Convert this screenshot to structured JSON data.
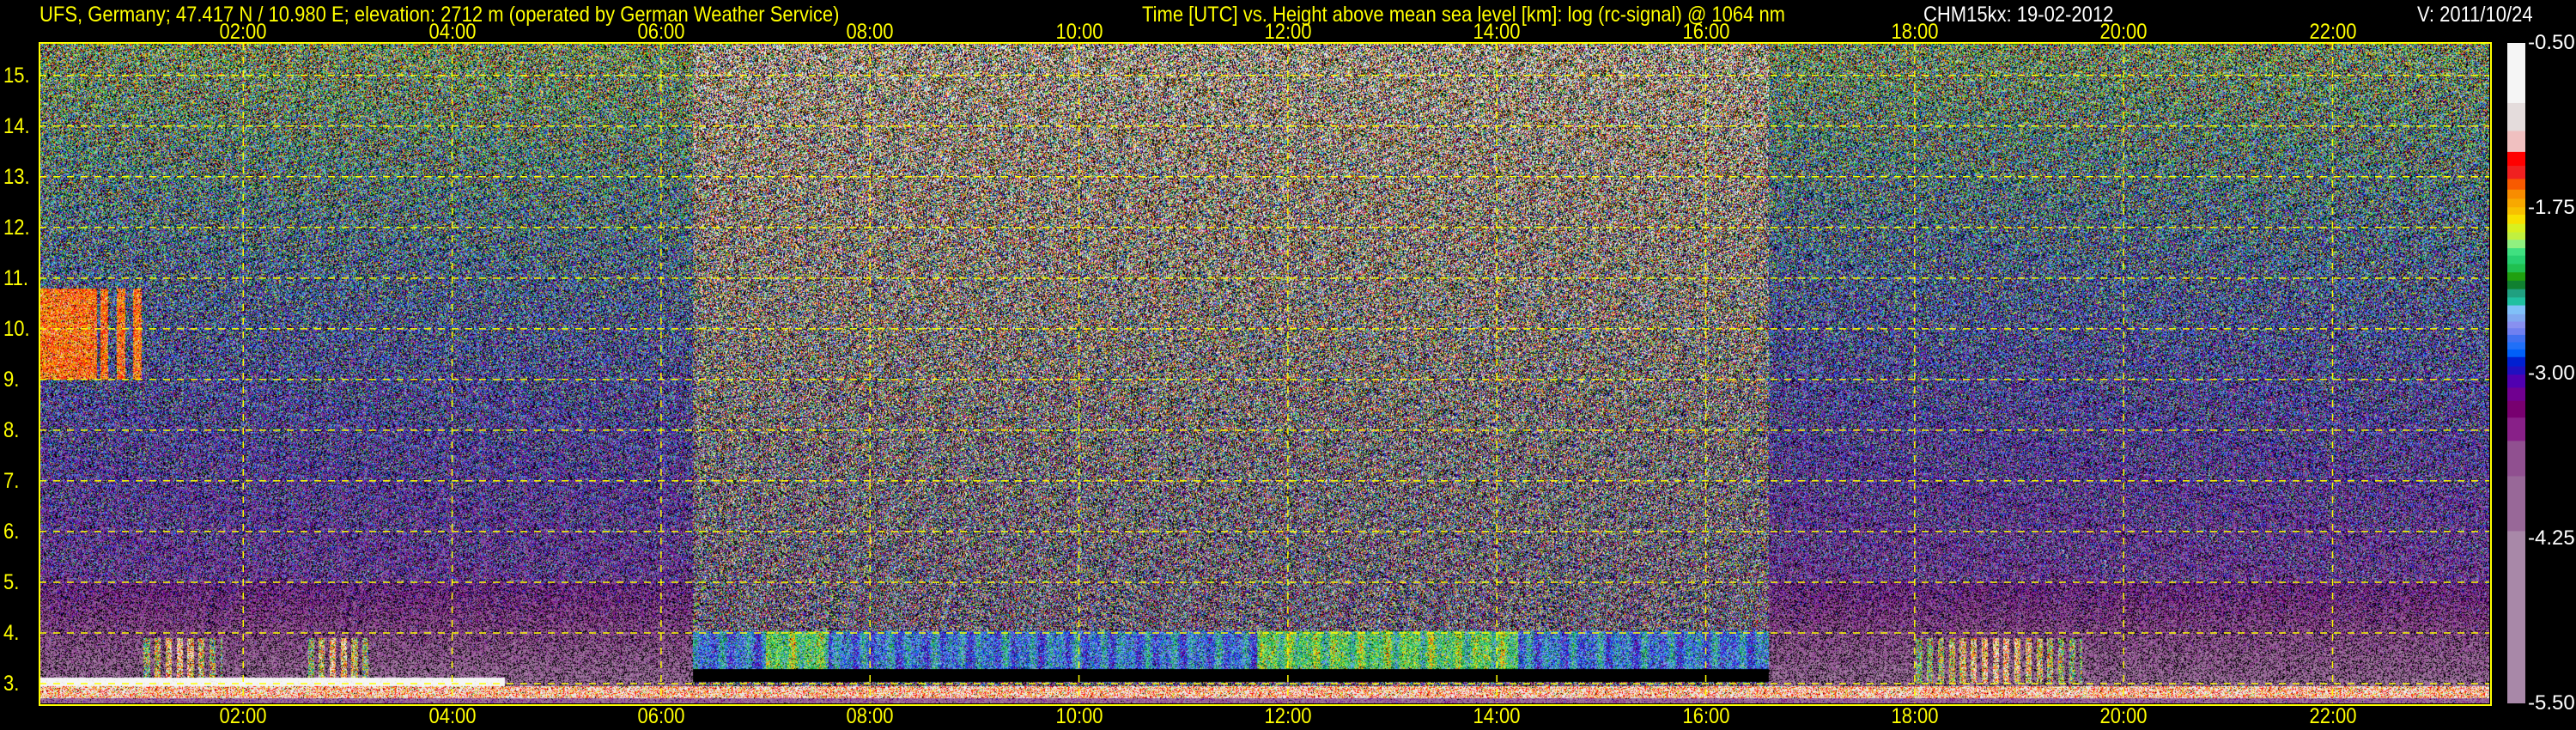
{
  "header": {
    "station": "UFS, Germany; 47.417 N / 10.980 E; elevation: 2712 m  (operated by German Weather Service)",
    "description": "Time [UTC] vs. Height above mean sea level [km]: log (rc-signal) @ 1064 nm",
    "instrument_date": "CHM15kx: 19-02-2012",
    "version": "V: 2011/10/24"
  },
  "chart_data": {
    "type": "heatmap",
    "title": "Time [UTC] vs. Height above mean sea level [km]: log (rc-signal) @ 1064 nm",
    "xlabel": "Time [UTC]",
    "ylabel": "Height above mean sea level [km]",
    "xlim_hours": [
      0.05,
      23.5
    ],
    "ylim_km": [
      2.61,
      15.64
    ],
    "x_ticks": [
      {
        "value": 2,
        "label": "02:00"
      },
      {
        "value": 4,
        "label": "04:00"
      },
      {
        "value": 6,
        "label": "06:00"
      },
      {
        "value": 8,
        "label": "08:00"
      },
      {
        "value": 10,
        "label": "10:00"
      },
      {
        "value": 12,
        "label": "12:00"
      },
      {
        "value": 14,
        "label": "14:00"
      },
      {
        "value": 16,
        "label": "16:00"
      },
      {
        "value": 18,
        "label": "18:00"
      },
      {
        "value": 20,
        "label": "20:00"
      },
      {
        "value": 22,
        "label": "22:00"
      }
    ],
    "y_ticks": [
      {
        "value": 3,
        "label": "3."
      },
      {
        "value": 4,
        "label": "4."
      },
      {
        "value": 5,
        "label": "5."
      },
      {
        "value": 6,
        "label": "6."
      },
      {
        "value": 7,
        "label": "7."
      },
      {
        "value": 8,
        "label": "8."
      },
      {
        "value": 9,
        "label": "9."
      },
      {
        "value": 10,
        "label": "10."
      },
      {
        "value": 11,
        "label": "11."
      },
      {
        "value": 12,
        "label": "12."
      },
      {
        "value": 13,
        "label": "13."
      },
      {
        "value": 14,
        "label": "14."
      },
      {
        "value": 15,
        "label": "15."
      }
    ],
    "grid": true,
    "grid_color": "#ffff00",
    "colorbar": {
      "range": [
        -5.5,
        -0.5
      ],
      "ticks": [
        {
          "value": -0.5,
          "label": "-0.50"
        },
        {
          "value": -1.75,
          "label": "-1.75"
        },
        {
          "value": -3.0,
          "label": "-3.00"
        },
        {
          "value": -4.25,
          "label": "-4.25"
        },
        {
          "value": -5.5,
          "label": "-5.50"
        }
      ],
      "levels": [
        {
          "lower": -0.955,
          "color": "#f5f5f5"
        },
        {
          "lower": -1.166,
          "color": "#e4dcdc"
        },
        {
          "lower": -1.325,
          "color": "#f0c0c0"
        },
        {
          "lower": -1.43,
          "color": "#ff0000"
        },
        {
          "lower": -1.53,
          "color": "#f02020"
        },
        {
          "lower": -1.61,
          "color": "#f85a00"
        },
        {
          "lower": -1.68,
          "color": "#f88c00"
        },
        {
          "lower": -1.744,
          "color": "#f8a800"
        },
        {
          "lower": -1.8,
          "color": "#f8c000"
        },
        {
          "lower": -1.87,
          "color": "#f8e000"
        },
        {
          "lower": -1.934,
          "color": "#d8f020"
        },
        {
          "lower": -1.99,
          "color": "#c0f040"
        },
        {
          "lower": -2.054,
          "color": "#90f080"
        },
        {
          "lower": -2.11,
          "color": "#40e080"
        },
        {
          "lower": -2.174,
          "color": "#28d070"
        },
        {
          "lower": -2.237,
          "color": "#20c050"
        },
        {
          "lower": -2.3,
          "color": "#20a010"
        },
        {
          "lower": -2.364,
          "color": "#108030"
        },
        {
          "lower": -2.427,
          "color": "#20a080"
        },
        {
          "lower": -2.487,
          "color": "#20c0a0"
        },
        {
          "lower": -2.554,
          "color": "#80c0f8"
        },
        {
          "lower": -2.61,
          "color": "#80a8f0"
        },
        {
          "lower": -2.66,
          "color": "#8890f0"
        },
        {
          "lower": -2.71,
          "color": "#7080f0"
        },
        {
          "lower": -2.766,
          "color": "#4070f0"
        },
        {
          "lower": -2.82,
          "color": "#2070f8"
        },
        {
          "lower": -2.878,
          "color": "#0060f8"
        },
        {
          "lower": -2.949,
          "color": "#0020d0"
        },
        {
          "lower": -3.012,
          "color": "#2010c0"
        },
        {
          "lower": -3.11,
          "color": "#5000b0"
        },
        {
          "lower": -3.21,
          "color": "#700090"
        },
        {
          "lower": -3.337,
          "color": "#780070"
        },
        {
          "lower": -3.513,
          "color": "#882088"
        },
        {
          "lower": -3.78,
          "color": "#905090"
        },
        {
          "lower": -4.196,
          "color": "#986898"
        },
        {
          "lower": -5.5,
          "color": "#a888a8"
        }
      ]
    },
    "features": {
      "daytime_background_hours": [
        6.3,
        16.6
      ],
      "cirrus": {
        "hours": [
          0.05,
          1.1
        ],
        "km": [
          9.0,
          10.8
        ]
      },
      "low_cloud_layer_day_km": [
        3.3,
        4.0
      ],
      "convective_clouds_hours": [
        [
          1.0,
          1.8
        ],
        [
          2.6,
          3.2
        ],
        [
          18.0,
          19.6
        ]
      ]
    }
  }
}
